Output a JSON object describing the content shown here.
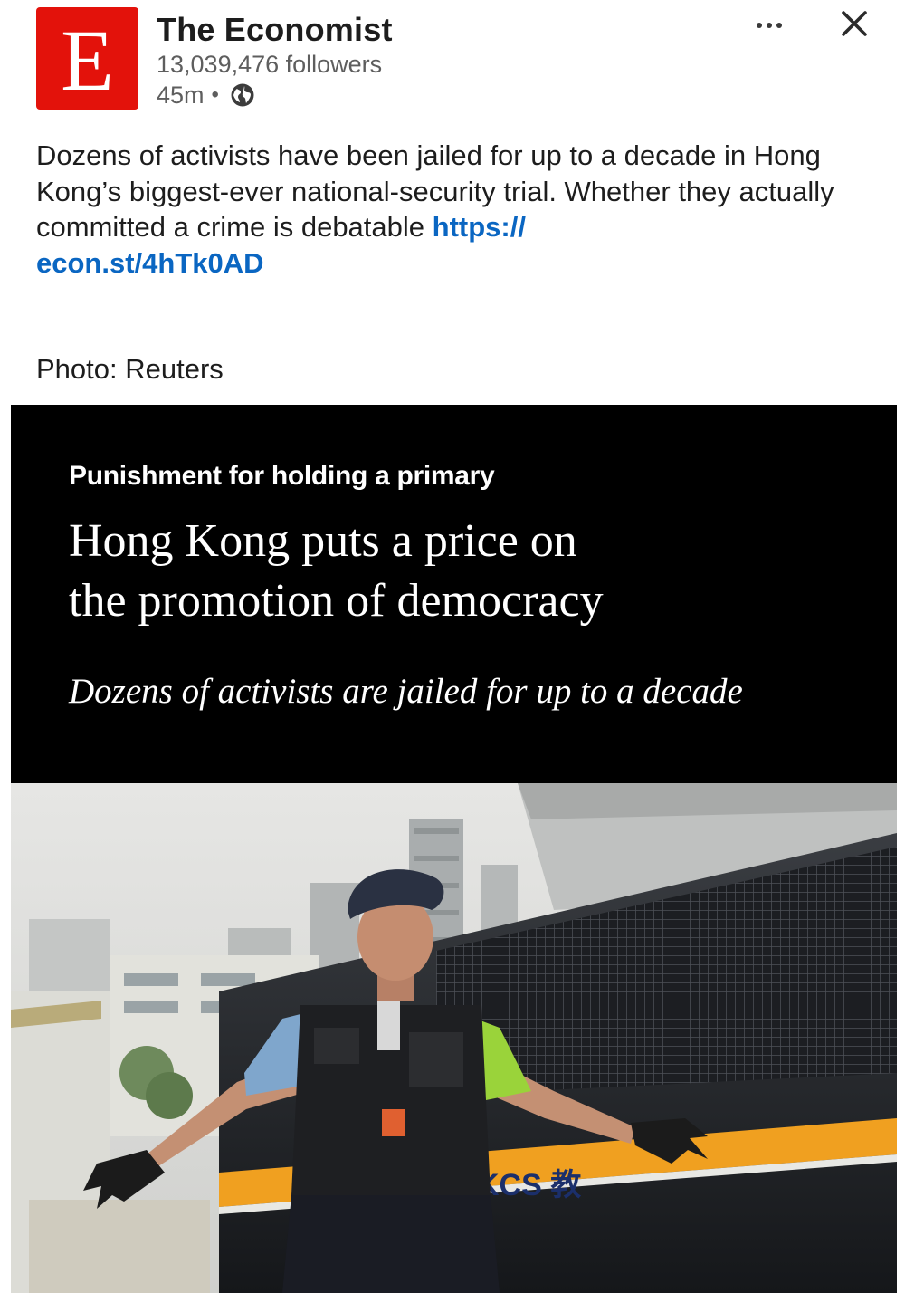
{
  "header": {
    "logo_letter": "E",
    "author_name": "The Economist",
    "followers": "13,039,476 followers",
    "time_ago": "45m",
    "separator": "•",
    "visibility_icon": "globe-icon",
    "more_icon": "more-horizontal-icon",
    "close_icon": "close-icon"
  },
  "post": {
    "text": "Dozens of activists have been jailed for up to a decade in Hong Kong’s biggest-ever national-security trial. Whether they actually committed a crime is debatable ",
    "link_line1": "https://",
    "link_line2": "econ.st/4hTk0AD",
    "photo_credit": "Photo: Reuters"
  },
  "article_image": {
    "kicker": "Punishment for holding a primary",
    "headline_line1": "Hong Kong puts a price on",
    "headline_line2": "the promotion of democracy",
    "rubric": "Dozens of activists are jailed for up to a decade",
    "van_text": "KCS 教"
  },
  "colors": {
    "brand_red": "#e3120b",
    "link_blue": "#0a66c2",
    "banner_black": "#000000"
  }
}
